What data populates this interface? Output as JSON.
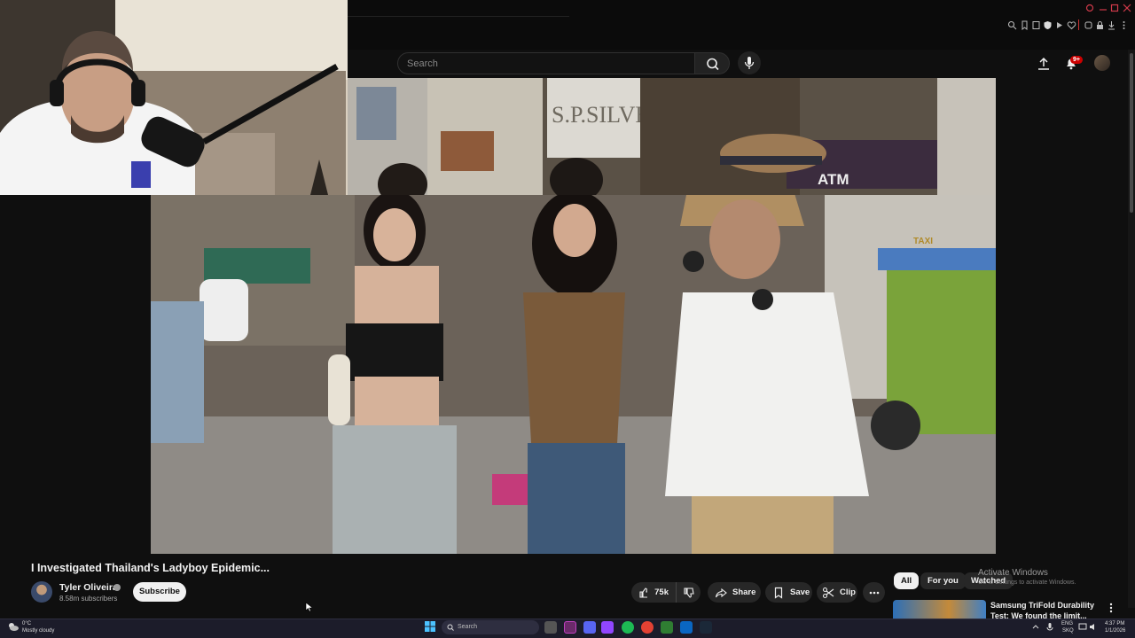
{
  "header": {
    "search_placeholder": "Search",
    "notification_count": "9+"
  },
  "video": {
    "title": "I Investigated Thailand's Ladyboy Epidemic...",
    "scene_signs": [
      "S.P.SILVE",
      "ATM",
      "TAXI"
    ]
  },
  "channel": {
    "name": "Tyler Oliveira",
    "subscribers": "8.58m subscribers",
    "subscribe_label": "Subscribe"
  },
  "actions": {
    "likes": "75k",
    "share_label": "Share",
    "save_label": "Save",
    "clip_label": "Clip"
  },
  "chips": [
    "All",
    "For you",
    "Watched"
  ],
  "watermark": {
    "title": "Activate Windows",
    "subtitle": "Go to Settings to activate Windows."
  },
  "recommendation": {
    "title": "Samsung TriFold Durability Test: We found the limit..."
  },
  "taskbar": {
    "weather_temp": "0°C",
    "weather_desc": "Mostly cloudy",
    "search_label": "Search",
    "lang_1": "ENG",
    "lang_2": "SKQ",
    "time": "4:37 PM",
    "date": "1/1/2026"
  },
  "colors": {
    "background": "#0f0f0f",
    "accent_red": "#cc0000",
    "pill_bg": "#272727"
  }
}
